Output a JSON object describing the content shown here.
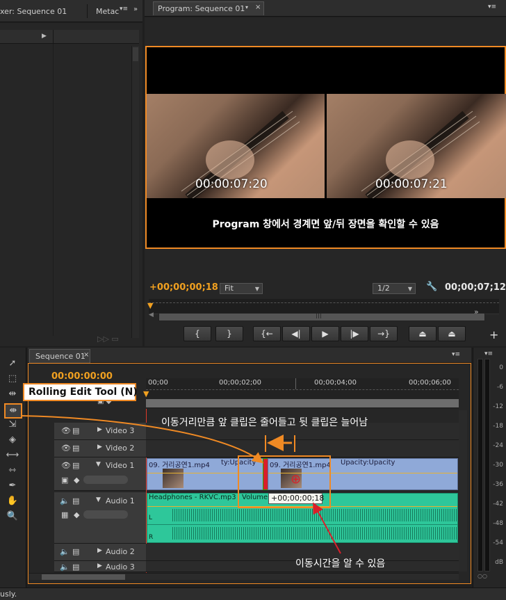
{
  "left_panel": {
    "tab1": "xer: Sequence 01",
    "tab2": "Metac"
  },
  "program": {
    "tab_label": "Program: Sequence 01",
    "timecode_left": "00:00:07:20",
    "timecode_right": "00:00:07:21",
    "caption": "Program 창에서 경계면 앞/뒤 장면을 확인할 수 있음",
    "current_time": "+00;00;00;18",
    "fit": "Fit",
    "resolution": "1/2",
    "duration": "00;00;07;12",
    "transport": [
      "{",
      "}",
      "{←",
      "◀|",
      "▶",
      "|▶",
      "→}",
      "",
      ""
    ]
  },
  "sequence": {
    "tab_label": "Sequence 01",
    "timecode": "00:00:00:00",
    "ruler": [
      "00;00",
      "00;00;02;00",
      "00;00;04;00",
      "00;00;06;00"
    ],
    "tracks": {
      "video3": "Video 3",
      "video2": "Video 2",
      "video1": "Video 1",
      "audio1": "Audio 1",
      "audio2": "Audio 2",
      "audio3": "Audio 3"
    },
    "clip1_label": "09. 거리공연1.mp4",
    "clip1_fx": "ty:Upacity",
    "clip2_label": "09. 거리공연1.mp4",
    "clip2_fx": "Upacity:Upacity",
    "audio_clip_label": "Headphones - RKVC.mp3",
    "volume_label": "Volume",
    "trim_offset": "+00;00;00;18",
    "channel_l": "L",
    "channel_r": "R"
  },
  "annotations": {
    "tool_name": "Rolling Edit Tool (N)",
    "desc_top": "이동거리만큼 앞 클립은 줄어들고 뒷 클립은 늘어남",
    "desc_bottom": "이동시간을 알 수 있음"
  },
  "meter_ticks": [
    "0",
    "-6",
    "-12",
    "-18",
    "-24",
    "-30",
    "-36",
    "-42",
    "-48",
    "-54",
    "dB"
  ],
  "status_text": "usly.",
  "colors": {
    "accent": "#f08a24",
    "video_clip": "#8fa9d8",
    "audio_clip": "#2ec79a",
    "playhead": "#e03a2a"
  }
}
